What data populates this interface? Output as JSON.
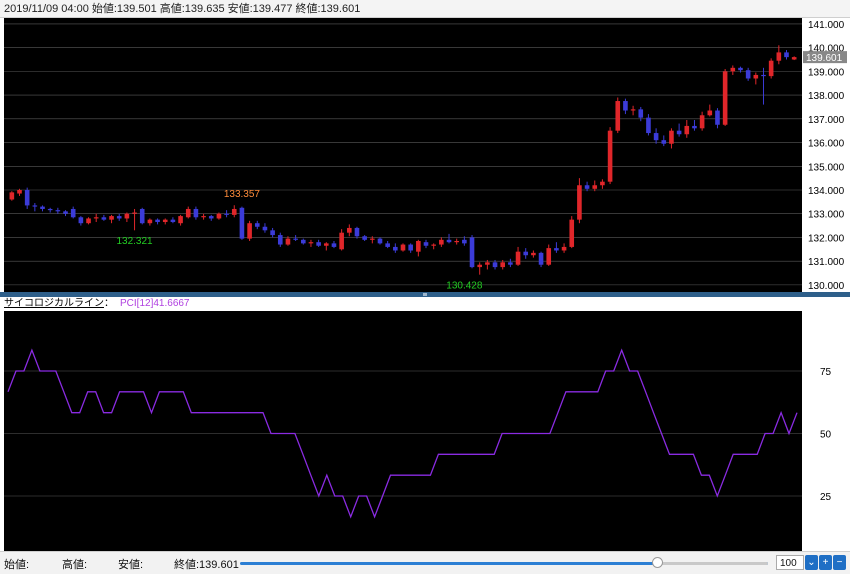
{
  "info_bar": {
    "text": "2019/11/09 04:00 始値:139.501 高値:139.635 安値:139.477 終値:139.601"
  },
  "indicator_header": {
    "name": "サイコロジカルライン",
    "colon": "：",
    "value": "PCI[12]41.6667"
  },
  "bottom_bar": {
    "open_label": "始値:",
    "high_label": "高値:",
    "low_label": "安値:",
    "close_label": "終値:139.601",
    "zoom_value": "100",
    "slider_fraction": 0.79
  },
  "colors": {
    "up": "#e0262a",
    "down": "#3b3bd8",
    "background": "#000000",
    "grid": "#5a5a5a",
    "indicator_line": "#8a2be2",
    "high_annotation": "#ff8c3a",
    "low_annotation": "#22cc22",
    "price_box": "#888888"
  },
  "chart_data": [
    {
      "type": "candlestick",
      "ylim": [
        129.7,
        141.25
      ],
      "yticks": [
        130,
        131,
        132,
        133,
        134,
        135,
        136,
        137,
        138,
        139,
        140,
        141
      ],
      "ytick_labels": [
        "130.000",
        "131.000",
        "132.000",
        "133.000",
        "134.000",
        "135.000",
        "136.000",
        "137.000",
        "138.000",
        "139.000",
        "140.000",
        "141.000"
      ],
      "grid": true,
      "current_price": 139.601,
      "current_price_label": "139.601",
      "annotations": [
        {
          "text": "133.357",
          "index": 30,
          "value": 133.357,
          "kind": "high"
        },
        {
          "text": "132.321",
          "index": 16,
          "value": 132.321,
          "kind": "low"
        },
        {
          "text": "130.428",
          "index": 59,
          "value": 130.428,
          "kind": "low"
        }
      ],
      "candles": [
        [
          133.6,
          133.95,
          133.55,
          133.9
        ],
        [
          133.85,
          134.05,
          133.75,
          134.0
        ],
        [
          134.0,
          134.1,
          133.2,
          133.35
        ],
        [
          133.35,
          133.45,
          133.1,
          133.3
        ],
        [
          133.3,
          133.35,
          133.1,
          133.2
        ],
        [
          133.2,
          133.25,
          133.05,
          133.15
        ],
        [
          133.15,
          133.25,
          133.0,
          133.1
        ],
        [
          133.1,
          133.15,
          132.9,
          133.0
        ],
        [
          133.2,
          133.3,
          132.8,
          132.85
        ],
        [
          132.85,
          132.9,
          132.5,
          132.6
        ],
        [
          132.6,
          132.85,
          132.55,
          132.8
        ],
        [
          132.8,
          133.0,
          132.65,
          132.85
        ],
        [
          132.85,
          132.95,
          132.7,
          132.75
        ],
        [
          132.75,
          132.95,
          132.6,
          132.9
        ],
        [
          132.9,
          133.0,
          132.7,
          132.8
        ],
        [
          132.8,
          133.05,
          132.65,
          133.0
        ],
        [
          133.0,
          133.2,
          132.3,
          133.05
        ],
        [
          133.2,
          133.25,
          132.55,
          132.6
        ],
        [
          132.6,
          132.8,
          132.5,
          132.75
        ],
        [
          132.75,
          132.8,
          132.55,
          132.65
        ],
        [
          132.65,
          132.8,
          132.55,
          132.75
        ],
        [
          132.75,
          132.85,
          132.6,
          132.65
        ],
        [
          132.6,
          132.95,
          132.5,
          132.9
        ],
        [
          132.85,
          133.3,
          132.8,
          133.2
        ],
        [
          133.2,
          133.3,
          132.75,
          132.85
        ],
        [
          132.85,
          133.0,
          132.75,
          132.9
        ],
        [
          132.9,
          132.95,
          132.7,
          132.8
        ],
        [
          132.8,
          133.05,
          132.75,
          133.0
        ],
        [
          133.0,
          133.15,
          132.85,
          132.95
        ],
        [
          132.95,
          133.357,
          132.85,
          133.2
        ],
        [
          133.25,
          133.3,
          131.9,
          131.95
        ],
        [
          131.95,
          132.7,
          131.85,
          132.6
        ],
        [
          132.6,
          132.7,
          132.35,
          132.45
        ],
        [
          132.45,
          132.6,
          132.2,
          132.3
        ],
        [
          132.3,
          132.4,
          132.0,
          132.1
        ],
        [
          132.1,
          132.2,
          131.6,
          131.7
        ],
        [
          131.7,
          132.05,
          131.65,
          131.95
        ],
        [
          131.95,
          132.1,
          131.85,
          131.9
        ],
        [
          131.9,
          131.95,
          131.7,
          131.75
        ],
        [
          131.75,
          131.9,
          131.6,
          131.8
        ],
        [
          131.8,
          131.9,
          131.6,
          131.65
        ],
        [
          131.65,
          131.8,
          131.45,
          131.75
        ],
        [
          131.75,
          131.85,
          131.55,
          131.6
        ],
        [
          131.5,
          132.35,
          131.45,
          132.2
        ],
        [
          132.2,
          132.55,
          132.05,
          132.4
        ],
        [
          132.4,
          132.45,
          131.95,
          132.05
        ],
        [
          132.05,
          132.1,
          131.85,
          131.9
        ],
        [
          131.9,
          132.05,
          131.75,
          131.95
        ],
        [
          131.95,
          132.0,
          131.7,
          131.75
        ],
        [
          131.75,
          131.85,
          131.55,
          131.6
        ],
        [
          131.6,
          131.75,
          131.35,
          131.45
        ],
        [
          131.45,
          131.75,
          131.4,
          131.7
        ],
        [
          131.7,
          131.75,
          131.35,
          131.45
        ],
        [
          131.4,
          131.9,
          131.2,
          131.85
        ],
        [
          131.8,
          131.9,
          131.55,
          131.65
        ],
        [
          131.65,
          131.75,
          131.5,
          131.7
        ],
        [
          131.7,
          132.0,
          131.6,
          131.9
        ],
        [
          131.9,
          132.15,
          131.75,
          131.8
        ],
        [
          131.8,
          131.95,
          131.7,
          131.85
        ],
        [
          131.9,
          132.05,
          131.65,
          131.75
        ],
        [
          132.0,
          132.1,
          130.7,
          130.75
        ],
        [
          130.75,
          130.95,
          130.43,
          130.85
        ],
        [
          130.85,
          131.05,
          130.65,
          130.95
        ],
        [
          130.95,
          131.05,
          130.65,
          130.75
        ],
        [
          130.75,
          131.05,
          130.65,
          130.95
        ],
        [
          130.95,
          131.1,
          130.75,
          130.85
        ],
        [
          130.85,
          131.6,
          130.8,
          131.4
        ],
        [
          131.4,
          131.55,
          131.1,
          131.25
        ],
        [
          131.25,
          131.45,
          131.15,
          131.35
        ],
        [
          131.35,
          131.4,
          130.75,
          130.85
        ],
        [
          130.85,
          131.7,
          130.8,
          131.55
        ],
        [
          131.55,
          131.8,
          131.35,
          131.45
        ],
        [
          131.45,
          131.75,
          131.35,
          131.6
        ],
        [
          131.6,
          132.9,
          131.55,
          132.75
        ],
        [
          132.75,
          134.5,
          132.6,
          134.2
        ],
        [
          134.2,
          134.35,
          133.95,
          134.05
        ],
        [
          134.05,
          134.4,
          133.95,
          134.2
        ],
        [
          134.2,
          134.45,
          134.05,
          134.35
        ],
        [
          134.35,
          136.65,
          134.25,
          136.5
        ],
        [
          136.5,
          137.9,
          136.4,
          137.75
        ],
        [
          137.75,
          137.85,
          137.2,
          137.35
        ],
        [
          137.35,
          137.55,
          137.15,
          137.4
        ],
        [
          137.4,
          137.5,
          136.9,
          137.05
        ],
        [
          137.05,
          137.2,
          136.3,
          136.4
        ],
        [
          136.4,
          136.6,
          135.95,
          136.1
        ],
        [
          136.1,
          136.3,
          135.85,
          135.95
        ],
        [
          135.95,
          136.6,
          135.75,
          136.5
        ],
        [
          136.5,
          136.8,
          136.25,
          136.35
        ],
        [
          136.35,
          136.95,
          136.2,
          136.7
        ],
        [
          136.7,
          136.95,
          136.5,
          136.6
        ],
        [
          136.6,
          137.3,
          136.5,
          137.15
        ],
        [
          137.15,
          137.6,
          137.1,
          137.35
        ],
        [
          137.35,
          137.45,
          136.6,
          136.75
        ],
        [
          136.75,
          139.1,
          136.7,
          139.0
        ],
        [
          139.0,
          139.25,
          138.85,
          139.15
        ],
        [
          139.15,
          139.2,
          138.95,
          139.05
        ],
        [
          139.05,
          139.15,
          138.6,
          138.7
        ],
        [
          138.7,
          138.95,
          138.45,
          138.85
        ],
        [
          138.85,
          139.15,
          137.6,
          138.8
        ],
        [
          138.8,
          139.55,
          138.7,
          139.45
        ],
        [
          139.45,
          140.1,
          139.3,
          139.8
        ],
        [
          139.8,
          139.9,
          139.5,
          139.6
        ],
        [
          139.501,
          139.635,
          139.477,
          139.601
        ]
      ]
    },
    {
      "type": "line",
      "series": [
        {
          "name": "PCI[12]",
          "values": [
            66.67,
            75,
            75,
            83.33,
            75,
            75,
            75,
            66.67,
            58.33,
            58.33,
            66.67,
            66.67,
            58.33,
            58.33,
            66.67,
            66.67,
            66.67,
            66.67,
            58.33,
            66.67,
            66.67,
            66.67,
            66.67,
            58.33,
            58.33,
            58.33,
            58.33,
            58.33,
            58.33,
            58.33,
            58.33,
            58.33,
            58.33,
            50,
            50,
            50,
            50,
            41.67,
            33.33,
            25,
            33.33,
            25,
            25,
            16.67,
            25,
            25,
            16.67,
            25,
            33.33,
            33.33,
            33.33,
            33.33,
            33.33,
            33.33,
            41.67,
            41.67,
            41.67,
            41.67,
            41.67,
            41.67,
            41.67,
            41.67,
            50,
            50,
            50,
            50,
            50,
            50,
            50,
            58.33,
            66.67,
            66.67,
            66.67,
            66.67,
            66.67,
            75,
            75,
            83.33,
            75,
            75,
            66.67,
            58.33,
            50,
            41.67,
            41.67,
            41.67,
            41.67,
            33.33,
            33.33,
            25,
            33.33,
            41.67,
            41.67,
            41.67,
            41.67,
            50,
            50,
            58.33,
            50,
            58.33
          ]
        }
      ],
      "ylim": [
        3,
        99
      ],
      "yticks": [
        25,
        50,
        75
      ],
      "ytick_labels": [
        "25",
        "50",
        "75"
      ],
      "grid": true
    }
  ]
}
